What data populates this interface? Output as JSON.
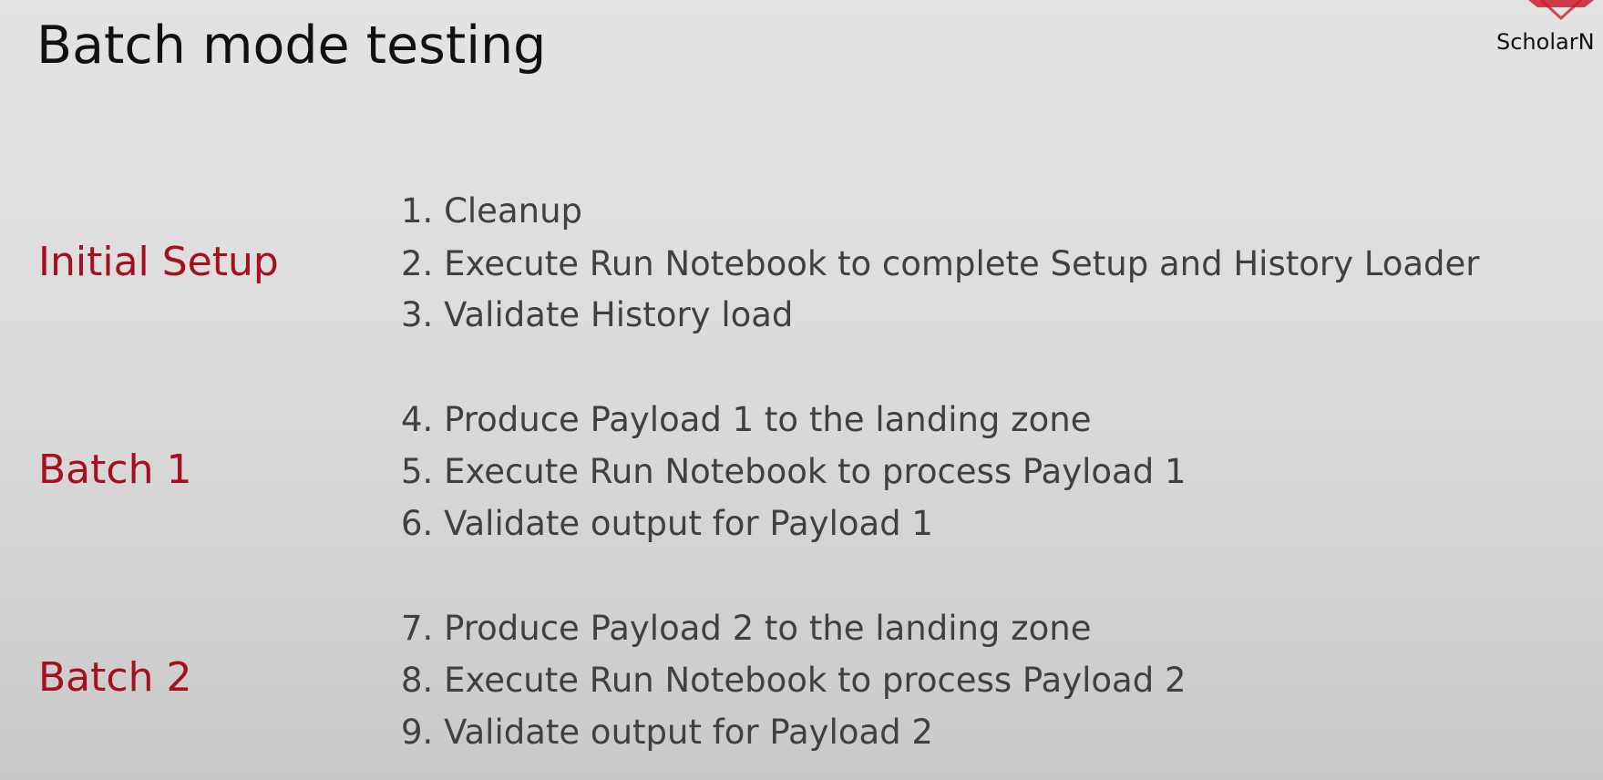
{
  "slide": {
    "title": "Batch mode testing",
    "logo_text": "ScholarN"
  },
  "sections": [
    {
      "label": "Initial Setup",
      "steps": [
        "1. Cleanup",
        "2. Execute Run Notebook to complete Setup and History Loader",
        "3. Validate History load"
      ]
    },
    {
      "label": "Batch 1",
      "steps": [
        "4. Produce Payload 1 to the landing zone",
        "5. Execute Run Notebook to process Payload 1",
        "6. Validate output for Payload 1"
      ]
    },
    {
      "label": "Batch 2",
      "steps": [
        "7. Produce Payload 2 to the landing zone",
        "8. Execute Run Notebook to process Payload 2",
        "9. Validate output for Payload 2"
      ]
    }
  ],
  "colors": {
    "section_label": "#a50f1e",
    "step_text": "#404040",
    "title_text": "#111111",
    "logo_accent": "#c8202c"
  }
}
